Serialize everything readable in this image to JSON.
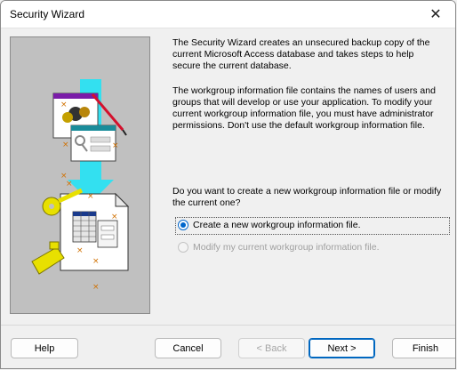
{
  "window": {
    "title": "Security Wizard"
  },
  "intro": {
    "paragraph1": "The Security Wizard creates an unsecured backup copy of the current Microsoft Access database and takes steps to help secure the current database.",
    "paragraph2": "The workgroup information file contains the names of users and groups that will develop or use your application. To modify your current workgroup information file, you must have administrator permissions. Don't use the default workgroup information file."
  },
  "question": "Do you want to create a new workgroup information file or modify the current one?",
  "options": [
    {
      "label": "Create a new workgroup information file.",
      "selected": true,
      "enabled": true
    },
    {
      "label": "Modify my current workgroup information file.",
      "selected": false,
      "enabled": false
    }
  ],
  "buttons": {
    "help": "Help",
    "cancel": "Cancel",
    "back": "< Back",
    "next": "Next >",
    "finish": "Finish"
  },
  "icons": {
    "close": "close-icon",
    "illustration": "security-wizard-illustration"
  }
}
